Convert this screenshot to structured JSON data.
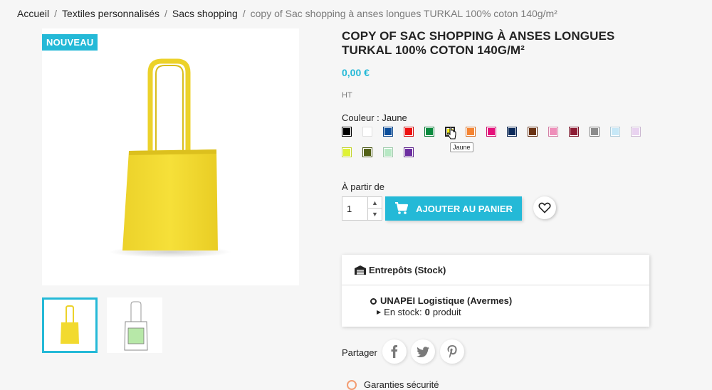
{
  "breadcrumb": {
    "items": [
      "Accueil",
      "Textiles personnalisés",
      "Sacs shopping"
    ],
    "current": "copy of Sac shopping à anses longues TURKAL 100% coton 140g/m²"
  },
  "product": {
    "badge": "NOUVEAU",
    "title": "COPY OF SAC SHOPPING À ANSES LONGUES TURKAL 100% COTON 140G/M²",
    "price": "0,00 €",
    "tax": "HT",
    "color_label": "Couleur : Jaune",
    "selected_color_tooltip": "Jaune",
    "swatches": [
      "#000000",
      "#ffffff",
      "#0d4f9c",
      "#ee1111",
      "#0c8b3f",
      "#f4ee1c",
      "#f58432",
      "#e6117a",
      "#0b2a5a",
      "#6b3415",
      "#ef8fba",
      "#8e1c34",
      "#8c8c8c",
      "#c7e8f7",
      "#e9d3f0",
      "#dff235",
      "#546217",
      "#b7e8c4",
      "#6d2ea1"
    ],
    "selected_index": 5,
    "product_color": "#f2da2f"
  },
  "cart": {
    "from_label": "À partir de",
    "quantity": "1",
    "add_button": "AJOUTER AU PANIER"
  },
  "stock": {
    "title": "Entrepôts (Stock)",
    "warehouse": "UNAPEI Logistique (Avermes)",
    "in_stock_prefix": "En stock:",
    "in_stock_count": "0",
    "in_stock_suffix": "produit"
  },
  "share": {
    "label": "Partager",
    "networks": [
      "facebook",
      "twitter",
      "pinterest"
    ]
  },
  "guarantee": "Garanties sécurité",
  "colors": {
    "accent": "#24b9d7",
    "text": "#232323",
    "muted": "#7a7a7a"
  }
}
